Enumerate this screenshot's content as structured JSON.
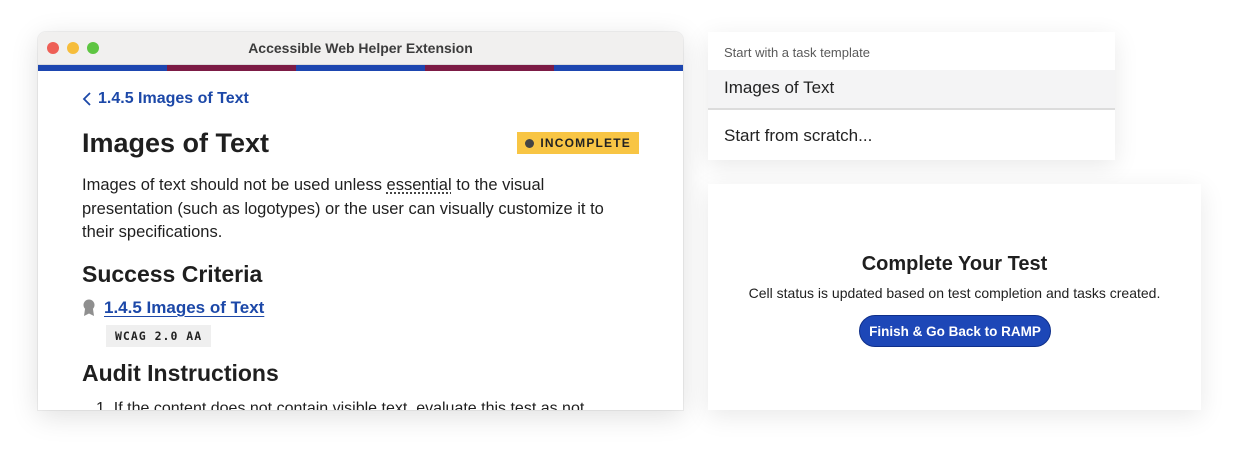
{
  "window": {
    "title": "Accessible Web Helper Extension",
    "stripe_colors": [
      "#1d46b0",
      "#7c1b45",
      "#1d46b0",
      "#7c1b45",
      "#1d46b0"
    ]
  },
  "breadcrumb": {
    "label": "1.4.5 Images of Text",
    "icon": "chevron-left-icon"
  },
  "page": {
    "title": "Images of Text",
    "status_badge": "INCOMPLETE",
    "description_before": "Images of text should not be used unless ",
    "description_term": "essential",
    "description_after": " to the visual presentation (such as logotypes) or the user can visually customize it to their specifications."
  },
  "success_criteria": {
    "heading": "Success Criteria",
    "link": "1.4.5 Images of Text",
    "level": "WCAG 2.0 AA",
    "icon": "award-icon"
  },
  "audit": {
    "heading": "Audit Instructions",
    "first_item": "1. If the content does not contain visible text, evaluate this test as not"
  },
  "template_menu": {
    "header": "Start with a task template",
    "option": "Images of Text",
    "scratch": "Start from scratch..."
  },
  "complete_panel": {
    "title": "Complete Your Test",
    "text": "Cell status is updated based on test completion and tasks created.",
    "button": "Finish & Go Back to RAMP"
  },
  "colors": {
    "accent_blue": "#1c48a8",
    "badge_yellow": "#f8c544",
    "button_blue": "#1d47b7"
  }
}
